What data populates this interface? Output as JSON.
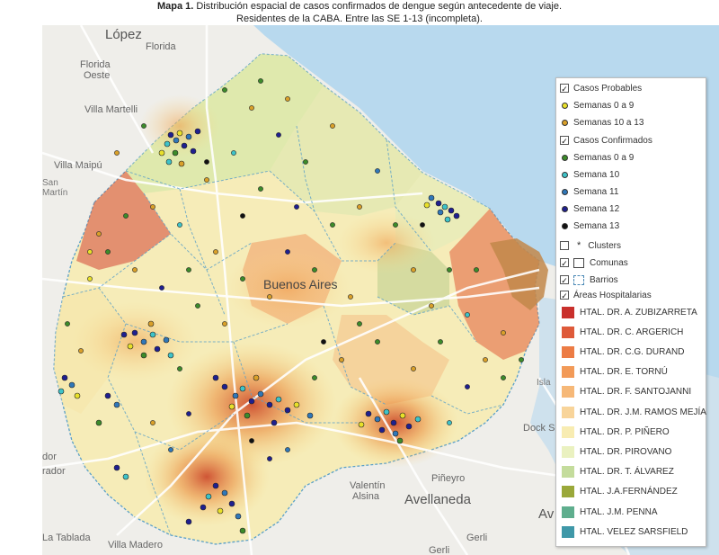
{
  "caption": {
    "bold": "Mapa 1.",
    "line1": " Distribución espacial de casos confirmados de dengue según antecedente de viaje.",
    "line2": "Residentes de la CABA. Entre las SE 1-13 (incompleta)."
  },
  "places": {
    "lopez": "López",
    "florida": "Florida",
    "florida_oeste_1": "Florida",
    "florida_oeste_2": "Oeste",
    "villa_martelli": "Villa Martelli",
    "villa_maipu": "Villa Maipú",
    "martin_1": "San",
    "martin_2": "Martín",
    "buenos_aires": "Buenos Aires",
    "valentin_1": "Valentín",
    "valentin_2": "Alsina",
    "avellaneda": "Avellaneda",
    "pineyro": "Piñeyro",
    "dock_sud_1": "Dock Sud",
    "gerli_1": "Gerli",
    "gerli_2": "Gerli",
    "la_tablada": "La Tablada",
    "villa_madero": "Villa Madero",
    "dor": "dor",
    "rador": "rador",
    "av": "Av",
    "isla": "Isla"
  },
  "colors": {
    "water": "#b8d9ee",
    "land": "#efeeea",
    "probables_0_9": "#e8e02a",
    "probables_10_13": "#d9a02a",
    "confirmados_0_9": "#3c8b2a",
    "semana_10": "#3ec3c8",
    "semana_11": "#3077b8",
    "semana_12": "#1f1f8f",
    "semana_13": "#111111"
  },
  "legend": {
    "probables_title": "Casos Probables",
    "probables_0_9": "Semanas 0 a 9",
    "probables_10_13": "Semanas 10 a 13",
    "confirmados_title": "Casos Confirmados",
    "confirmados_0_9": "Semanas 0 a 9",
    "semana_10": "Semana 10",
    "semana_11": "Semana 11",
    "semana_12": "Semana 12",
    "semana_13": "Semana 13",
    "clusters": "Clusters",
    "comunas": "Comunas",
    "barrios": "Barrios",
    "areas": "Áreas Hospitalarias",
    "hospitals": [
      {
        "name": "HTAL. DR. A. ZUBIZARRETA",
        "color": "#c9302c"
      },
      {
        "name": "HTAL. DR. C. ARGERICH",
        "color": "#de5a3a"
      },
      {
        "name": "HTAL. DR. C.G. DURAND",
        "color": "#ec7c45"
      },
      {
        "name": "HTAL. DR. E. TORNÚ",
        "color": "#f29a58"
      },
      {
        "name": "HTAL. DR. F. SANTOJANNI",
        "color": "#f6b878"
      },
      {
        "name": "HTAL. DR. J.M. RAMOS MEJÍA",
        "color": "#f8d49a"
      },
      {
        "name": "HTAL. DR. P. PIÑERO",
        "color": "#f8ecb2"
      },
      {
        "name": "HTAL. DR. PIROVANO",
        "color": "#eaf1c0"
      },
      {
        "name": "HTAL. DR. T. ÁLVAREZ",
        "color": "#c4dc9c"
      },
      {
        "name": "HTAL. J.A.FERNÁNDEZ",
        "color": "#9aa83a"
      },
      {
        "name": "HTAL. J.M. PENNA",
        "color": "#5fae8e"
      },
      {
        "name": "HTAL. VELEZ SARSFIELD",
        "color": "#3f98a8"
      }
    ]
  }
}
